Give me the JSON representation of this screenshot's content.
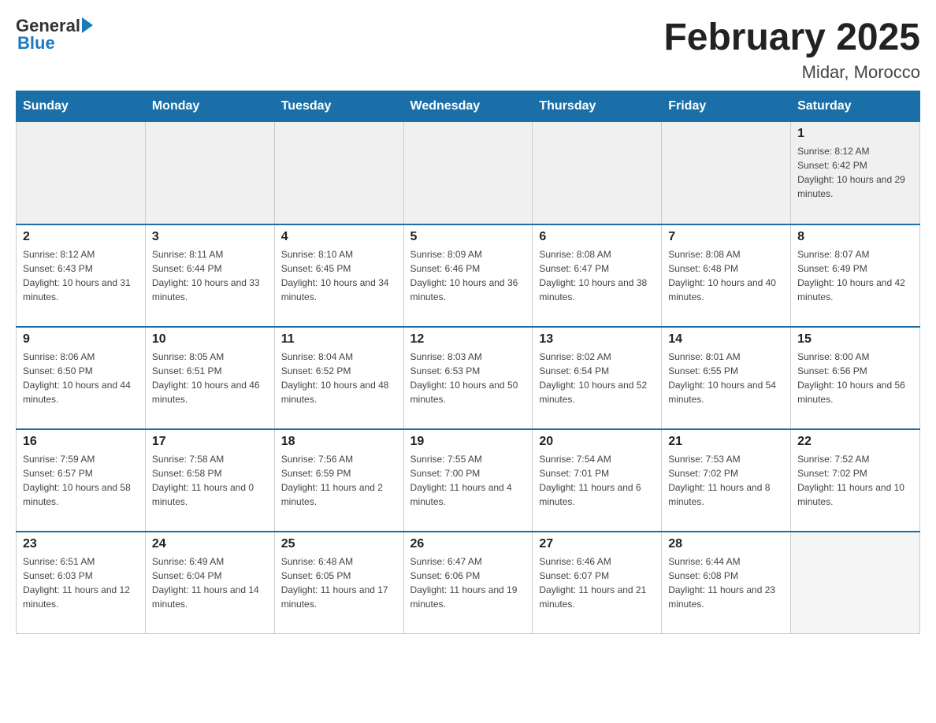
{
  "logo": {
    "general": "General",
    "blue": "Blue"
  },
  "title": "February 2025",
  "subtitle": "Midar, Morocco",
  "days_of_week": [
    "Sunday",
    "Monday",
    "Tuesday",
    "Wednesday",
    "Thursday",
    "Friday",
    "Saturday"
  ],
  "weeks": [
    {
      "days": [
        {
          "number": "",
          "info": ""
        },
        {
          "number": "",
          "info": ""
        },
        {
          "number": "",
          "info": ""
        },
        {
          "number": "",
          "info": ""
        },
        {
          "number": "",
          "info": ""
        },
        {
          "number": "",
          "info": ""
        },
        {
          "number": "1",
          "info": "Sunrise: 8:12 AM\nSunset: 6:42 PM\nDaylight: 10 hours and 29 minutes."
        }
      ]
    },
    {
      "days": [
        {
          "number": "2",
          "info": "Sunrise: 8:12 AM\nSunset: 6:43 PM\nDaylight: 10 hours and 31 minutes."
        },
        {
          "number": "3",
          "info": "Sunrise: 8:11 AM\nSunset: 6:44 PM\nDaylight: 10 hours and 33 minutes."
        },
        {
          "number": "4",
          "info": "Sunrise: 8:10 AM\nSunset: 6:45 PM\nDaylight: 10 hours and 34 minutes."
        },
        {
          "number": "5",
          "info": "Sunrise: 8:09 AM\nSunset: 6:46 PM\nDaylight: 10 hours and 36 minutes."
        },
        {
          "number": "6",
          "info": "Sunrise: 8:08 AM\nSunset: 6:47 PM\nDaylight: 10 hours and 38 minutes."
        },
        {
          "number": "7",
          "info": "Sunrise: 8:08 AM\nSunset: 6:48 PM\nDaylight: 10 hours and 40 minutes."
        },
        {
          "number": "8",
          "info": "Sunrise: 8:07 AM\nSunset: 6:49 PM\nDaylight: 10 hours and 42 minutes."
        }
      ]
    },
    {
      "days": [
        {
          "number": "9",
          "info": "Sunrise: 8:06 AM\nSunset: 6:50 PM\nDaylight: 10 hours and 44 minutes."
        },
        {
          "number": "10",
          "info": "Sunrise: 8:05 AM\nSunset: 6:51 PM\nDaylight: 10 hours and 46 minutes."
        },
        {
          "number": "11",
          "info": "Sunrise: 8:04 AM\nSunset: 6:52 PM\nDaylight: 10 hours and 48 minutes."
        },
        {
          "number": "12",
          "info": "Sunrise: 8:03 AM\nSunset: 6:53 PM\nDaylight: 10 hours and 50 minutes."
        },
        {
          "number": "13",
          "info": "Sunrise: 8:02 AM\nSunset: 6:54 PM\nDaylight: 10 hours and 52 minutes."
        },
        {
          "number": "14",
          "info": "Sunrise: 8:01 AM\nSunset: 6:55 PM\nDaylight: 10 hours and 54 minutes."
        },
        {
          "number": "15",
          "info": "Sunrise: 8:00 AM\nSunset: 6:56 PM\nDaylight: 10 hours and 56 minutes."
        }
      ]
    },
    {
      "days": [
        {
          "number": "16",
          "info": "Sunrise: 7:59 AM\nSunset: 6:57 PM\nDaylight: 10 hours and 58 minutes."
        },
        {
          "number": "17",
          "info": "Sunrise: 7:58 AM\nSunset: 6:58 PM\nDaylight: 11 hours and 0 minutes."
        },
        {
          "number": "18",
          "info": "Sunrise: 7:56 AM\nSunset: 6:59 PM\nDaylight: 11 hours and 2 minutes."
        },
        {
          "number": "19",
          "info": "Sunrise: 7:55 AM\nSunset: 7:00 PM\nDaylight: 11 hours and 4 minutes."
        },
        {
          "number": "20",
          "info": "Sunrise: 7:54 AM\nSunset: 7:01 PM\nDaylight: 11 hours and 6 minutes."
        },
        {
          "number": "21",
          "info": "Sunrise: 7:53 AM\nSunset: 7:02 PM\nDaylight: 11 hours and 8 minutes."
        },
        {
          "number": "22",
          "info": "Sunrise: 7:52 AM\nSunset: 7:02 PM\nDaylight: 11 hours and 10 minutes."
        }
      ]
    },
    {
      "days": [
        {
          "number": "23",
          "info": "Sunrise: 6:51 AM\nSunset: 6:03 PM\nDaylight: 11 hours and 12 minutes."
        },
        {
          "number": "24",
          "info": "Sunrise: 6:49 AM\nSunset: 6:04 PM\nDaylight: 11 hours and 14 minutes."
        },
        {
          "number": "25",
          "info": "Sunrise: 6:48 AM\nSunset: 6:05 PM\nDaylight: 11 hours and 17 minutes."
        },
        {
          "number": "26",
          "info": "Sunrise: 6:47 AM\nSunset: 6:06 PM\nDaylight: 11 hours and 19 minutes."
        },
        {
          "number": "27",
          "info": "Sunrise: 6:46 AM\nSunset: 6:07 PM\nDaylight: 11 hours and 21 minutes."
        },
        {
          "number": "28",
          "info": "Sunrise: 6:44 AM\nSunset: 6:08 PM\nDaylight: 11 hours and 23 minutes."
        },
        {
          "number": "",
          "info": ""
        }
      ]
    }
  ]
}
